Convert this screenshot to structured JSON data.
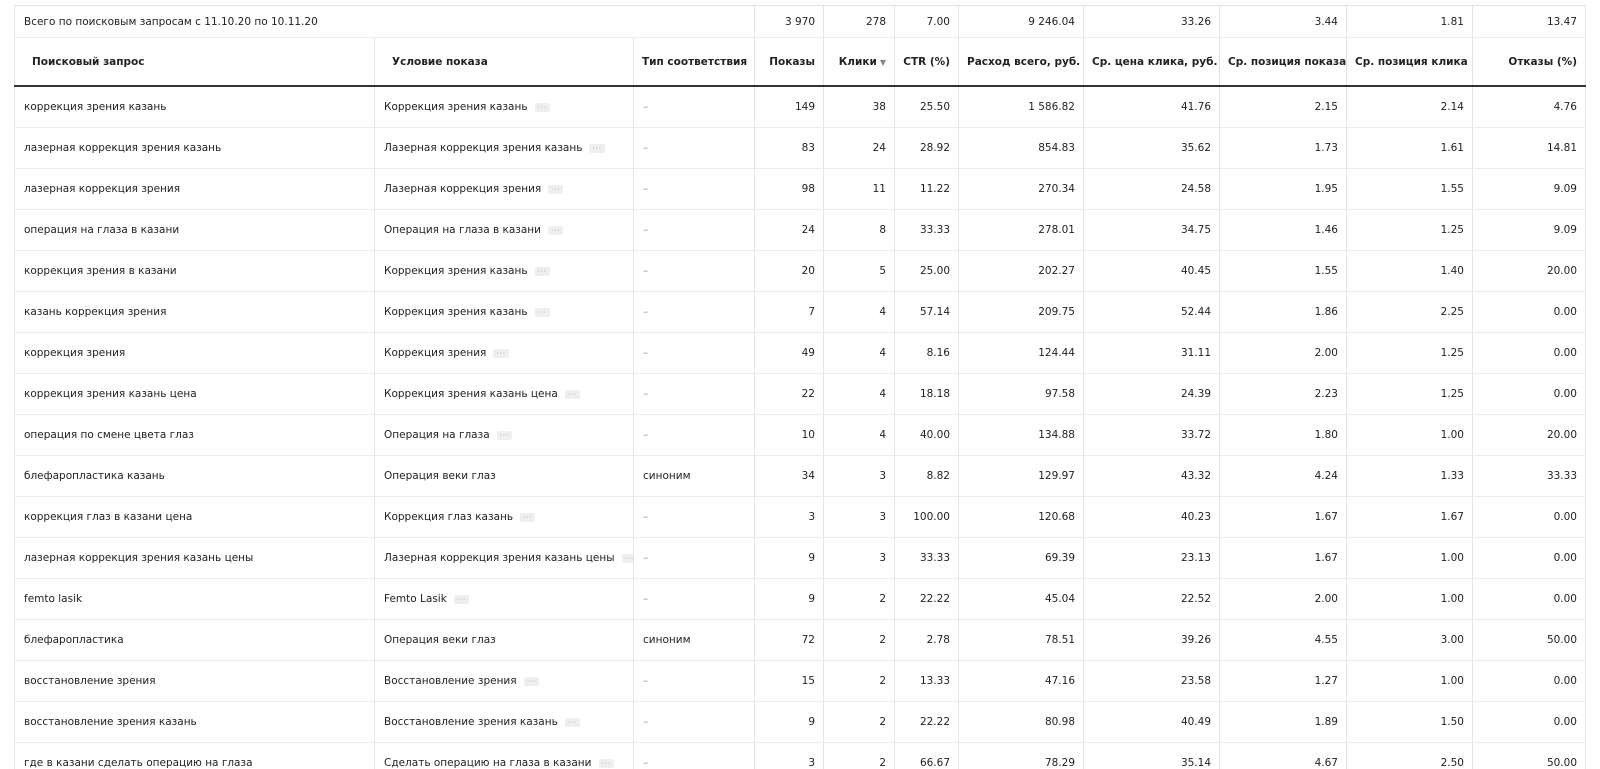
{
  "summary": {
    "label": "Всего по поисковым запросам с 11.10.20 по 10.11.20",
    "values": [
      "3 970",
      "278",
      "7.00",
      "9 246.04",
      "33.26",
      "3.44",
      "1.81",
      "13.47"
    ]
  },
  "columns": [
    "Поисковый запрос",
    "Условие показа",
    "Тип соответствия",
    "Показы",
    "Клики",
    "CTR (%)",
    "Расход всего, руб.",
    "Ср. цена клика, руб.",
    "Ср. позиция показа",
    "Ср. позиция клика",
    "Отказы (%)"
  ],
  "sort_icon": "sort-down-triangle",
  "rows": [
    {
      "query": "коррекция зрения казань",
      "condition": "Коррекция зрения казань",
      "more": "···",
      "match": "–",
      "v": [
        "149",
        "38",
        "25.50",
        "1 586.82",
        "41.76",
        "2.15",
        "2.14",
        "4.76"
      ]
    },
    {
      "query": "лазерная коррекция зрения казань",
      "condition": "Лазерная коррекция зрения казань",
      "more": "···",
      "match": "–",
      "v": [
        "83",
        "24",
        "28.92",
        "854.83",
        "35.62",
        "1.73",
        "1.61",
        "14.81"
      ]
    },
    {
      "query": "лазерная коррекция зрения",
      "condition": "Лазерная коррекция зрения",
      "more": "···",
      "match": "–",
      "v": [
        "98",
        "11",
        "11.22",
        "270.34",
        "24.58",
        "1.95",
        "1.55",
        "9.09"
      ]
    },
    {
      "query": "операция на глаза в казани",
      "condition": "Операция на глаза в казани",
      "more": "···",
      "match": "–",
      "v": [
        "24",
        "8",
        "33.33",
        "278.01",
        "34.75",
        "1.46",
        "1.25",
        "9.09"
      ]
    },
    {
      "query": "коррекция зрения в казани",
      "condition": "Коррекция зрения казань",
      "more": "···",
      "match": "–",
      "v": [
        "20",
        "5",
        "25.00",
        "202.27",
        "40.45",
        "1.55",
        "1.40",
        "20.00"
      ]
    },
    {
      "query": "казань коррекция зрения",
      "condition": "Коррекция зрения казань",
      "more": "···",
      "match": "–",
      "v": [
        "7",
        "4",
        "57.14",
        "209.75",
        "52.44",
        "1.86",
        "2.25",
        "0.00"
      ]
    },
    {
      "query": "коррекция зрения",
      "condition": "Коррекция зрения",
      "more": "···",
      "match": "–",
      "v": [
        "49",
        "4",
        "8.16",
        "124.44",
        "31.11",
        "2.00",
        "1.25",
        "0.00"
      ]
    },
    {
      "query": "коррекция зрения казань цена",
      "condition": "Коррекция зрения казань цена",
      "more": "···",
      "match": "–",
      "v": [
        "22",
        "4",
        "18.18",
        "97.58",
        "24.39",
        "2.23",
        "1.25",
        "0.00"
      ]
    },
    {
      "query": "операция по смене цвета глаз",
      "condition": "Операция на глаза",
      "more": "···",
      "match": "–",
      "v": [
        "10",
        "4",
        "40.00",
        "134.88",
        "33.72",
        "1.80",
        "1.00",
        "20.00"
      ]
    },
    {
      "query": "блефаропластика казань",
      "condition": "Операция веки глаз",
      "more": "",
      "match": "синоним",
      "v": [
        "34",
        "3",
        "8.82",
        "129.97",
        "43.32",
        "4.24",
        "1.33",
        "33.33"
      ]
    },
    {
      "query": "коррекция глаз в казани цена",
      "condition": "Коррекция глаз казань",
      "more": "···",
      "match": "–",
      "v": [
        "3",
        "3",
        "100.00",
        "120.68",
        "40.23",
        "1.67",
        "1.67",
        "0.00"
      ]
    },
    {
      "query": "лазерная коррекция зрения казань цены",
      "condition": "Лазерная коррекция зрения казань цены",
      "more": "···",
      "match": "–",
      "v": [
        "9",
        "3",
        "33.33",
        "69.39",
        "23.13",
        "1.67",
        "1.00",
        "0.00"
      ]
    },
    {
      "query": "femto lasik",
      "condition": "Femto Lasik",
      "more": "···",
      "match": "–",
      "v": [
        "9",
        "2",
        "22.22",
        "45.04",
        "22.52",
        "2.00",
        "1.00",
        "0.00"
      ]
    },
    {
      "query": "блефаропластика",
      "condition": "Операция веки глаз",
      "more": "",
      "match": "синоним",
      "v": [
        "72",
        "2",
        "2.78",
        "78.51",
        "39.26",
        "4.55",
        "3.00",
        "50.00"
      ]
    },
    {
      "query": "восстановление зрения",
      "condition": "Восстановление зрения",
      "more": "···",
      "match": "–",
      "v": [
        "15",
        "2",
        "13.33",
        "47.16",
        "23.58",
        "1.27",
        "1.00",
        "0.00"
      ]
    },
    {
      "query": "восстановление зрения казань",
      "condition": "Восстановление зрения казань",
      "more": "···",
      "match": "–",
      "v": [
        "9",
        "2",
        "22.22",
        "80.98",
        "40.49",
        "1.89",
        "1.50",
        "0.00"
      ]
    },
    {
      "query": "где в казани сделать операцию на глаза",
      "condition": "Сделать операцию на глаза в казани",
      "more": "···",
      "match": "–",
      "v": [
        "3",
        "2",
        "66.67",
        "78.29",
        "35.14",
        "4.67",
        "2.50",
        "50.00"
      ]
    }
  ]
}
